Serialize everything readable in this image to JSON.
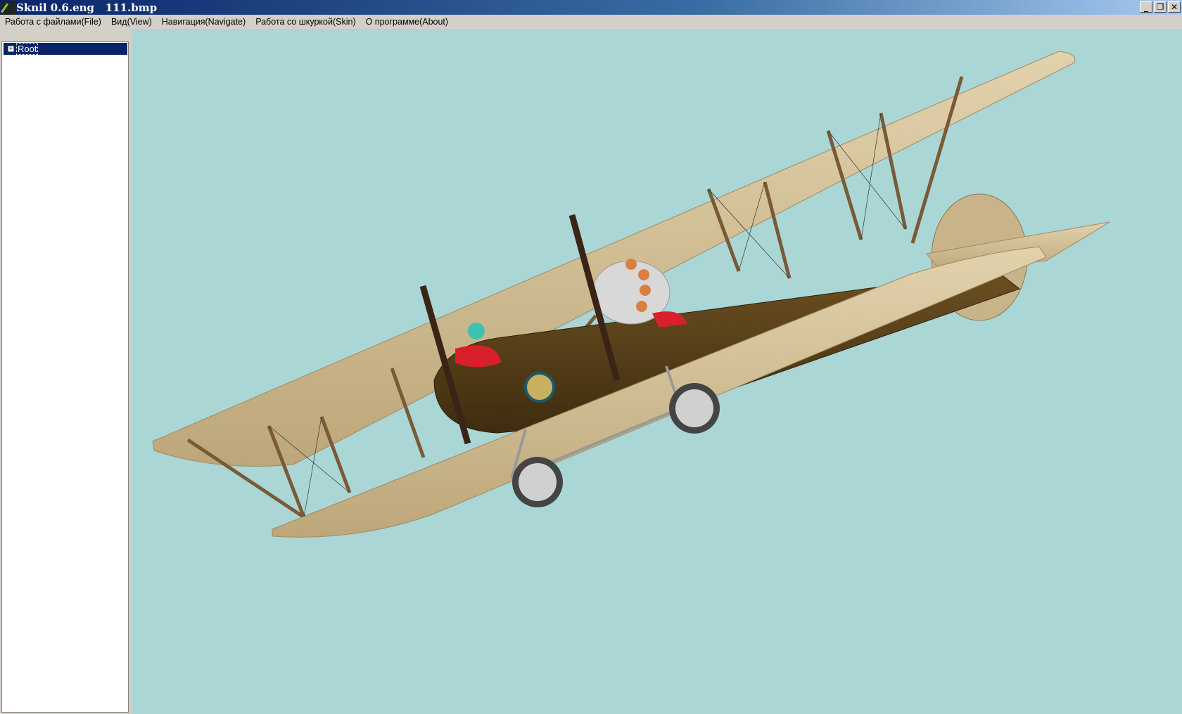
{
  "window": {
    "title": "Sknil 0.6.eng   111.bmp",
    "buttons": {
      "minimize": "_",
      "maximize": "❐",
      "close": "✕"
    }
  },
  "menu": [
    {
      "label": "Работа с файлами(File)"
    },
    {
      "label": "Вид(View)"
    },
    {
      "label": "Навигация(Navigate)"
    },
    {
      "label": "Работа со шкуркой(Skin)"
    },
    {
      "label": "О программе(About)"
    }
  ],
  "tree": {
    "expander": "+",
    "root": "Root"
  },
  "colors": {
    "viewport": "#aad6d6",
    "wing": "#d2be94",
    "fuselage": "#5b4218",
    "strut": "#7a5a36"
  }
}
